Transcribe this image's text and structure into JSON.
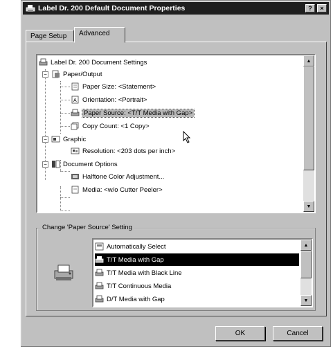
{
  "window": {
    "title": "Label Dr. 200 Default Document Properties",
    "help_button": "?",
    "close_button": "×"
  },
  "tabs": [
    {
      "label": "Page Setup",
      "active": false
    },
    {
      "label": "Advanced",
      "active": true
    }
  ],
  "tree": {
    "root": "Label Dr. 200 Document Settings",
    "paper_output": "Paper/Output",
    "paper_size": "Paper Size: <Statement>",
    "orientation": "Orientation: <Portrait>",
    "paper_source": "Paper Source: <T/T Media with Gap>",
    "copy_count": "Copy Count: <1 Copy>",
    "graphic": "Graphic",
    "resolution": "Resolution: <203 dots per inch>",
    "document_options": "Document Options",
    "halftone": "Halftone Color Adjustment...",
    "media": "Media: <w/o Cutter Peeler>",
    "expand_minus": "−"
  },
  "change_group": {
    "label": "Change 'Paper Source' Setting",
    "options": [
      {
        "label": "Automatically Select",
        "selected": false,
        "icon": "auto-select-icon"
      },
      {
        "label": "T/T Media with Gap",
        "selected": true,
        "icon": "printer-icon"
      },
      {
        "label": "T/T Media with Black Line",
        "selected": false,
        "icon": "printer-icon"
      },
      {
        "label": "T/T Continuous Media",
        "selected": false,
        "icon": "printer-icon"
      },
      {
        "label": "D/T Media with Gap",
        "selected": false,
        "icon": "printer-icon"
      }
    ]
  },
  "buttons": {
    "ok": "OK",
    "cancel": "Cancel"
  },
  "colors": {
    "titlebar": "#1f1f1f",
    "face": "#c0c0c0",
    "selection": "#000000"
  }
}
